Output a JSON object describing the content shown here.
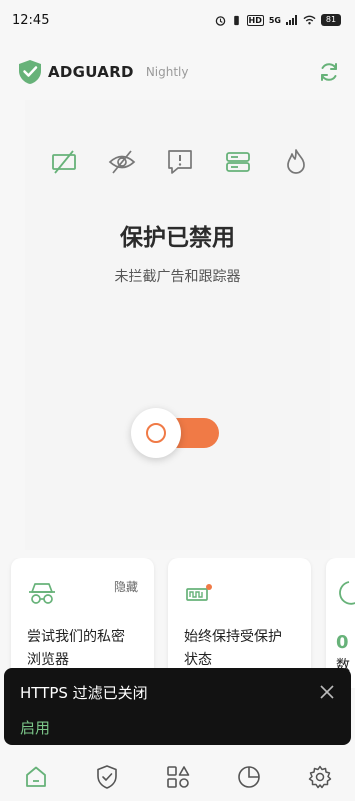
{
  "status_bar": {
    "time": "12:45",
    "hd": "HD",
    "network": "5G",
    "battery": "81"
  },
  "header": {
    "brand": "ADGUARD",
    "edition": "Nightly"
  },
  "feature_icons": [
    "ad-blocking-off-icon",
    "tracking-off-icon",
    "annoyance-icon",
    "dns-icon",
    "firewall-icon"
  ],
  "protection": {
    "title": "保护已禁用",
    "subtitle": "未拦截广告和跟踪器",
    "enabled": false
  },
  "cards": [
    {
      "icon": "incognito-icon",
      "hide_label": "隐藏",
      "text": "尝试我们的私密浏览器"
    },
    {
      "icon": "battery-alert-icon",
      "text": "始终保持受保护状态"
    },
    {
      "icon": "stats-icon",
      "value": "0",
      "text": "数"
    }
  ],
  "snackbar": {
    "message": "HTTPS 过滤已关闭",
    "action": "启用"
  },
  "bottom_nav": [
    "home-icon",
    "protection-icon",
    "apps-icon",
    "statistics-icon",
    "settings-icon"
  ],
  "colors": {
    "accent_green": "#67b279",
    "toggle_orange": "#f07a46",
    "snackbar_bg": "#121212"
  }
}
